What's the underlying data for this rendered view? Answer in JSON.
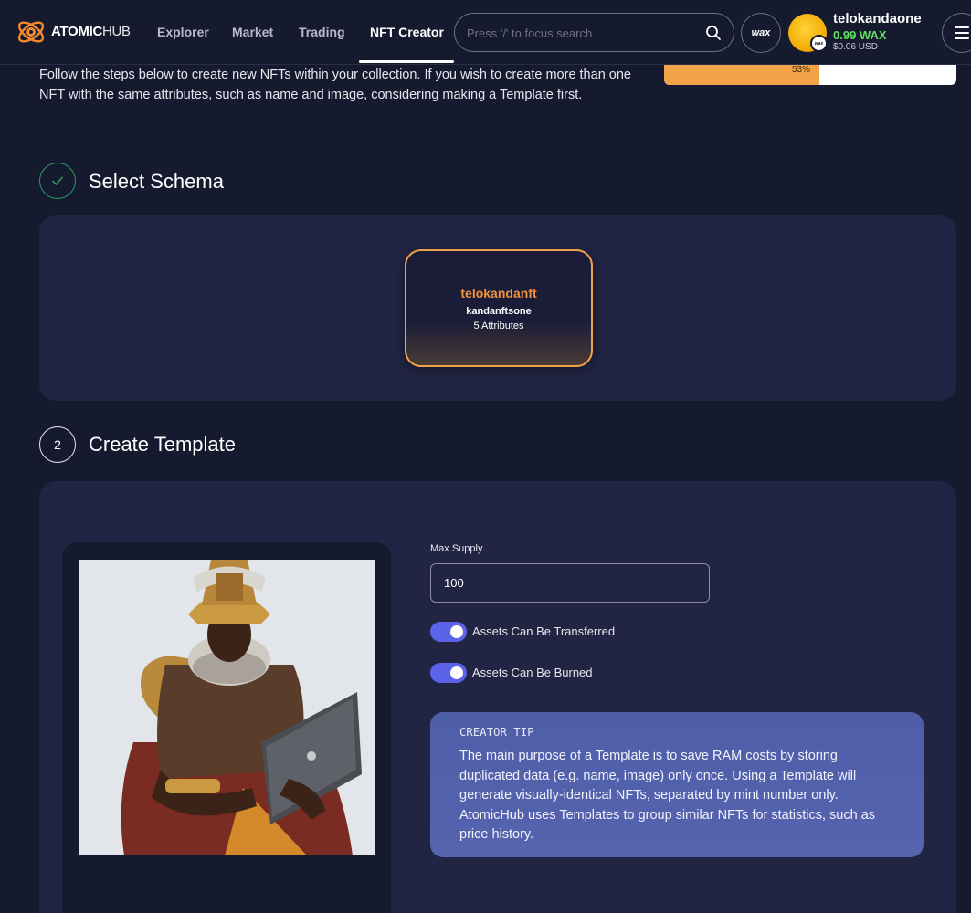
{
  "nav": {
    "logo_bold": "ATOMIC",
    "logo_light": "HUB",
    "links": [
      {
        "label": "Explorer"
      },
      {
        "label": "Market"
      },
      {
        "label": "Trading"
      },
      {
        "label": "NFT Creator"
      }
    ],
    "active_link": "NFT Creator",
    "search_placeholder": "Press '/' to focus search",
    "wax_label": "wax",
    "avatar_badge": "wax",
    "user": {
      "name": "telokandaone",
      "balance": "0.99 WAX",
      "usd": "$0.06 USD"
    }
  },
  "intro": {
    "text": "Follow the steps below to create new NFTs within your collection. If you wish to create more than one NFT with the same attributes, such as name and image, considering making a Template first.",
    "progress_label": "53%",
    "progress_value": 0.53
  },
  "steps": {
    "schema": {
      "title": "Select Schema",
      "card": {
        "name": "telokandanft",
        "schema": "kandanftsone",
        "attributes": "5 Attributes"
      }
    },
    "template": {
      "number": "2",
      "title": "Create Template",
      "max_supply_label": "Max Supply",
      "max_supply_value": "100",
      "toggle_transfer_label": "Assets Can Be Transferred",
      "toggle_burn_label": "Assets Can Be Burned",
      "tip_title": "CREATOR TIP",
      "tip_body": "The main purpose of a Template is to save RAM costs by storing duplicated data (e.g. name, image) only once. Using a Template will generate visually-identical NFTs, separated by mint number only. AtomicHub uses Templates to group similar NFTs for statistics, such as price history."
    }
  },
  "colors": {
    "background": "#161a2e",
    "panel": "#212443",
    "accent_orange": "#f0913a",
    "toggle": "#5b63e8",
    "balance_green": "#5fe05f",
    "tip": "#5060aa"
  }
}
